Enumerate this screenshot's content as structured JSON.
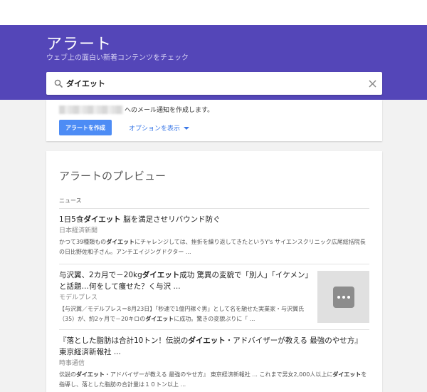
{
  "header": {
    "title": "アラート",
    "subtitle": "ウェブ上の面白い新着コンテンツをチェック",
    "bg_color": "#5446b8"
  },
  "search": {
    "value": "ダイエット",
    "icon": "search-icon",
    "clear_icon": "close-icon"
  },
  "email_card": {
    "notice_text": "へのメール通知を作成します。",
    "create_button": "アラートを作成",
    "options_link": "オプションを表示",
    "accent_color": "#4d8cf5"
  },
  "preview": {
    "title": "アラートのプレビュー",
    "section": "ニュース",
    "items": [
      {
        "title_pre": "1日5食",
        "title_kw": "ダイエット",
        "title_post": " 脳を満足させリバウンド防ぐ",
        "source": "日本経済新聞",
        "snippet_1": "かつて39種類もの",
        "snippet_kw": "ダイエット",
        "snippet_2": "にチャレンジしては、挫折を繰り返してきたというY's サイエンスクリニック広尾総括院長の日比野佐和子さん。アンチエイジングドクター ..."
      },
      {
        "title_pre": "与沢翼、2カ月で－20kg",
        "title_kw": "ダイエット",
        "title_post": "成功 驚異の変貌で「別人」「イケメン」と話題…何をして痩せた？く与沢 ...",
        "source": "モデルプレス",
        "snippet_1": "【与沢翼／モデルプレス＝8月23日】「秒速で1億円稼ぐ男」として名を馳せた実業家・与沢翼氏（35）が、約2ヶ月で－20キロの",
        "snippet_kw": "ダイエット",
        "snippet_2": "に成功。驚きの変貌ぶりに「 ..."
      },
      {
        "title_pre": "『落とした脂肪は合計10トン！伝説の",
        "title_kw": "ダイエット",
        "title_post": "・アドバイザーが教える 最強のやせ方』 東京経済新報社 ...",
        "source": "時事通信",
        "snippet_1": "伝説の",
        "snippet_kw": "ダイエット",
        "snippet_2": "・アドバイザーが教える 最強のやせ方』 東京経済新報社 ... これまで男女2,000人以上に",
        "snippet_kw2": "ダイエット",
        "snippet_3": "を指導し、落とした脂肪の合計量は１０トン以上 ..."
      }
    ]
  }
}
